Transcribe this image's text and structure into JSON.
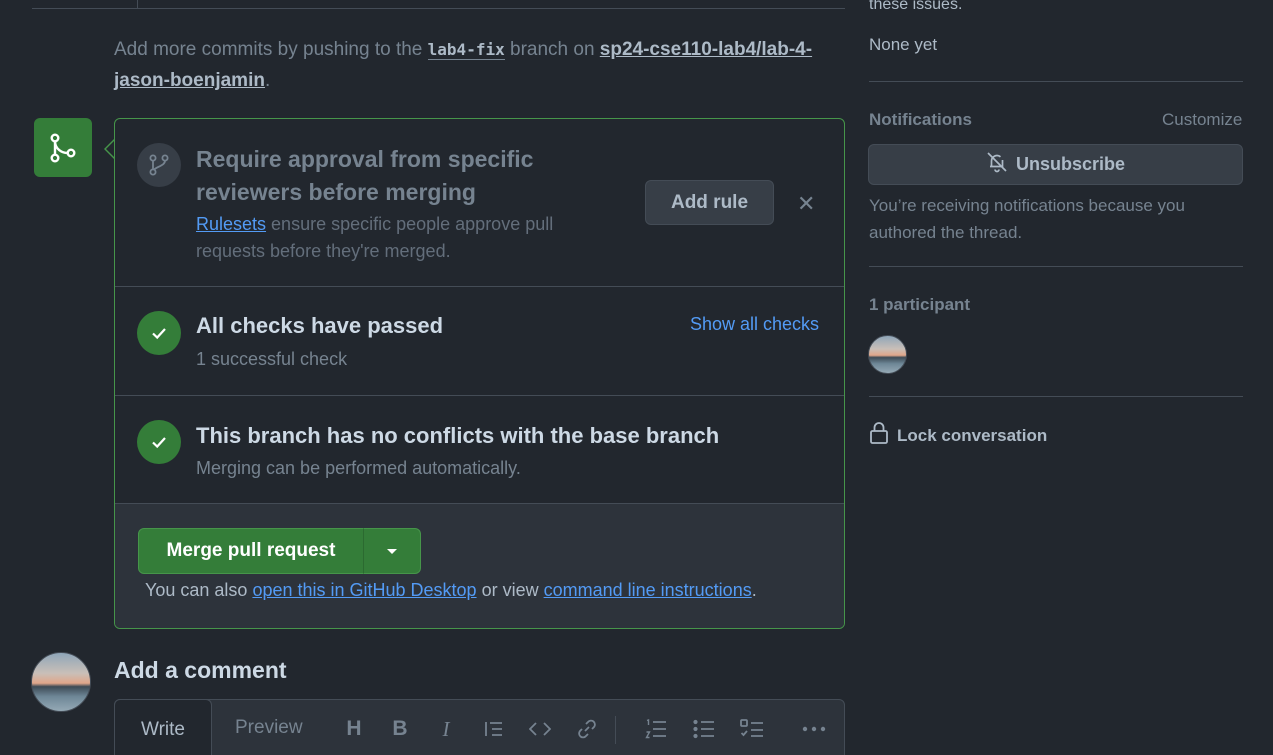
{
  "push_message": {
    "prefix": "Add more commits by pushing to the",
    "branch": "lab4-fix",
    "middle": "branch on",
    "repo": "sp24-cse110-lab4/lab-4-jason-boenjamin",
    "suffix": "."
  },
  "ruleset": {
    "title": "Require approval from specific reviewers before merging",
    "link": "Rulesets",
    "desc": "ensure specific people approve pull requests before they're merged.",
    "add_rule": "Add rule",
    "close": "✕"
  },
  "checks": {
    "title": "All checks have passed",
    "sub": "1 successful check",
    "show_all": "Show all checks"
  },
  "conflicts": {
    "title": "This branch has no conflicts with the base branch",
    "sub": "Merging can be performed automatically."
  },
  "merge": {
    "button": "Merge pull request",
    "also_prefix": "You can also",
    "desktop_link": "open this in GitHub Desktop",
    "or_view": "or view",
    "cli_link": "command line instructions",
    "period": "."
  },
  "comment": {
    "title": "Add a comment",
    "tab_write": "Write",
    "tab_preview": "Preview"
  },
  "sidebar": {
    "issues_tail": "these issues.",
    "none_yet": "None yet",
    "notifications_label": "Notifications",
    "customize": "Customize",
    "unsubscribe": "Unsubscribe",
    "notif_reason": "You’re receiving notifications because you authored the thread.",
    "participants": "1 participant",
    "lock": "Lock conversation"
  },
  "colors": {
    "accent_green": "#347d39",
    "link_blue": "#539bf5",
    "background": "#22272e"
  }
}
